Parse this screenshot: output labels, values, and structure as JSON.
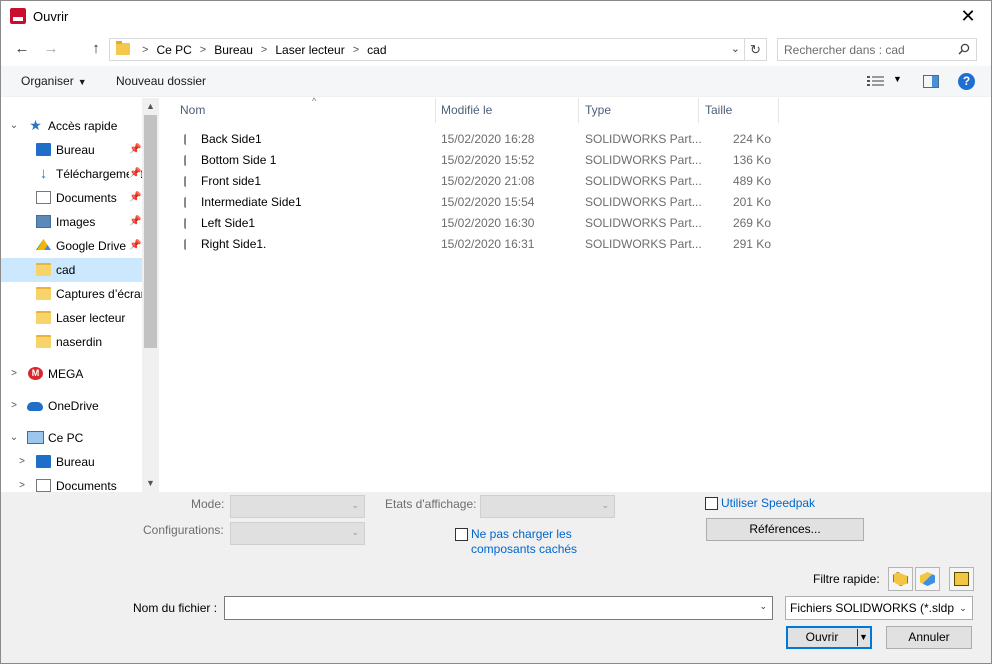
{
  "window": {
    "title": "Ouvrir",
    "close_glyph": "✕"
  },
  "nav": {
    "back_glyph": "←",
    "forward_glyph": "→",
    "up_glyph": "↑",
    "refresh_glyph": "↻"
  },
  "address": {
    "segments": [
      "Ce PC",
      "Bureau",
      "Laser lecteur",
      "cad"
    ],
    "separator": ">",
    "dropdown_glyph": "⌄"
  },
  "search": {
    "placeholder": "Rechercher dans : cad"
  },
  "toolbar": {
    "organize_label": "Organiser",
    "new_folder_label": "Nouveau dossier",
    "help_label": "?"
  },
  "sidebar": {
    "items": [
      {
        "label": "Accès rapide",
        "icon": "star-icon",
        "expander": "⌄"
      },
      {
        "label": "Bureau",
        "icon": "desktop-icon",
        "pinned": true
      },
      {
        "label": "Téléchargements",
        "icon": "download-icon",
        "pinned": true
      },
      {
        "label": "Documents",
        "icon": "documents-icon",
        "pinned": true
      },
      {
        "label": "Images",
        "icon": "images-icon",
        "pinned": true
      },
      {
        "label": "Google Drive",
        "icon": "google-drive-icon",
        "pinned": true
      },
      {
        "label": "cad",
        "icon": "folder-icon",
        "selected": true
      },
      {
        "label": "Captures d’écran",
        "icon": "folder-icon"
      },
      {
        "label": "Laser lecteur",
        "icon": "folder-icon"
      },
      {
        "label": "naserdin",
        "icon": "folder-icon"
      },
      {
        "label": "MEGA",
        "icon": "mega-icon",
        "expander": ">"
      },
      {
        "label": "OneDrive",
        "icon": "onedrive-icon",
        "expander": ">"
      },
      {
        "label": "Ce PC",
        "icon": "computer-icon",
        "expander": "⌄"
      },
      {
        "label": "Bureau",
        "icon": "desktop-icon",
        "expander": ">"
      },
      {
        "label": "Documents",
        "icon": "documents-icon",
        "expander": ">"
      }
    ],
    "pin_glyph": "📌"
  },
  "filelist": {
    "columns": [
      "Nom",
      "Modifié le",
      "Type",
      "Taille"
    ],
    "sort_glyph": "^",
    "rows": [
      {
        "name": "Back Side1",
        "modified": "15/02/2020 16:28",
        "type": "SOLIDWORKS Part...",
        "size": "224 Ko"
      },
      {
        "name": "Bottom Side 1",
        "modified": "15/02/2020 15:52",
        "type": "SOLIDWORKS Part...",
        "size": "136 Ko"
      },
      {
        "name": "Front side1",
        "modified": "15/02/2020 21:08",
        "type": "SOLIDWORKS Part...",
        "size": "489 Ko"
      },
      {
        "name": "Intermediate Side1",
        "modified": "15/02/2020 15:54",
        "type": "SOLIDWORKS Part...",
        "size": "201 Ko"
      },
      {
        "name": "Left Side1",
        "modified": "15/02/2020 16:30",
        "type": "SOLIDWORKS Part...",
        "size": "269 Ko"
      },
      {
        "name": "Right Side1.",
        "modified": "15/02/2020 16:31",
        "type": "SOLIDWORKS Part...",
        "size": "291 Ko"
      }
    ]
  },
  "options": {
    "mode_label": "Mode:",
    "configurations_label": "Configurations:",
    "display_states_label": "Etats d'affichage:",
    "speedpak_label": "Utiliser Speedpak",
    "references_label": "Références...",
    "hidden_components_line1": "Ne pas charger les",
    "hidden_components_line2": "composants cachés",
    "quick_filter_label": "Filtre rapide:"
  },
  "footer": {
    "filename_label": "Nom du fichier :",
    "filename_value": "",
    "filetype_value": "Fichiers SOLIDWORKS (*.sldprt;",
    "open_label": "Ouvrir",
    "cancel_label": "Annuler"
  }
}
